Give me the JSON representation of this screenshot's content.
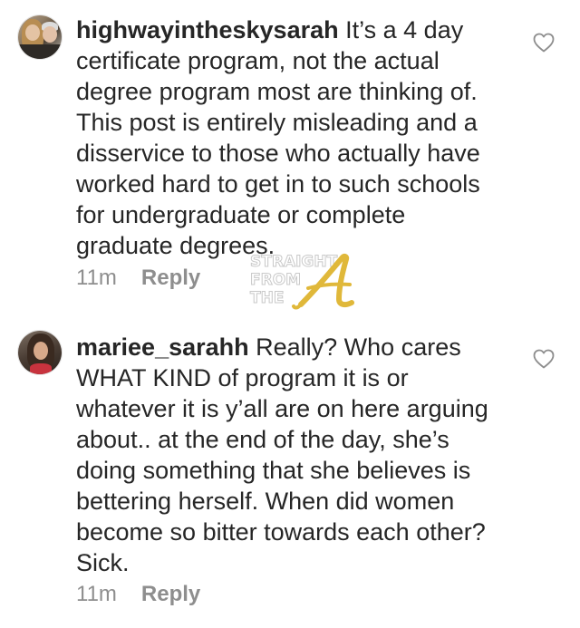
{
  "comments": [
    {
      "username": "highwayintheskysarah",
      "text": "It’s a 4 day certificate program, not the actual degree program most are thinking of. This post is entirely misleading and a disservice to those who actually have worked hard to get in to such schools for undergraduate or complete graduate degrees.",
      "time": "11m",
      "reply_label": "Reply",
      "avatar_icon": "profile-photo",
      "like_icon": "heart-outline-icon"
    },
    {
      "username": "mariee_sarahh",
      "text": "Really? Who cares WHAT KIND of program it is or whatever it is y’all are on here arguing about.. at the end of the day, she’s doing something that she believes is bettering herself. When did women become so bitter towards each other? Sick.",
      "time": "11m",
      "reply_label": "Reply",
      "avatar_icon": "profile-photo",
      "like_icon": "heart-outline-icon"
    }
  ],
  "watermark": {
    "line1": "STRAIGHT",
    "line2": "FROM",
    "line3": "THE",
    "logo_letter": "A",
    "logo_color": "#e0b83a"
  },
  "colors": {
    "text": "#262626",
    "meta": "#8e8e8e",
    "heart_stroke": "#8e8e8e"
  }
}
